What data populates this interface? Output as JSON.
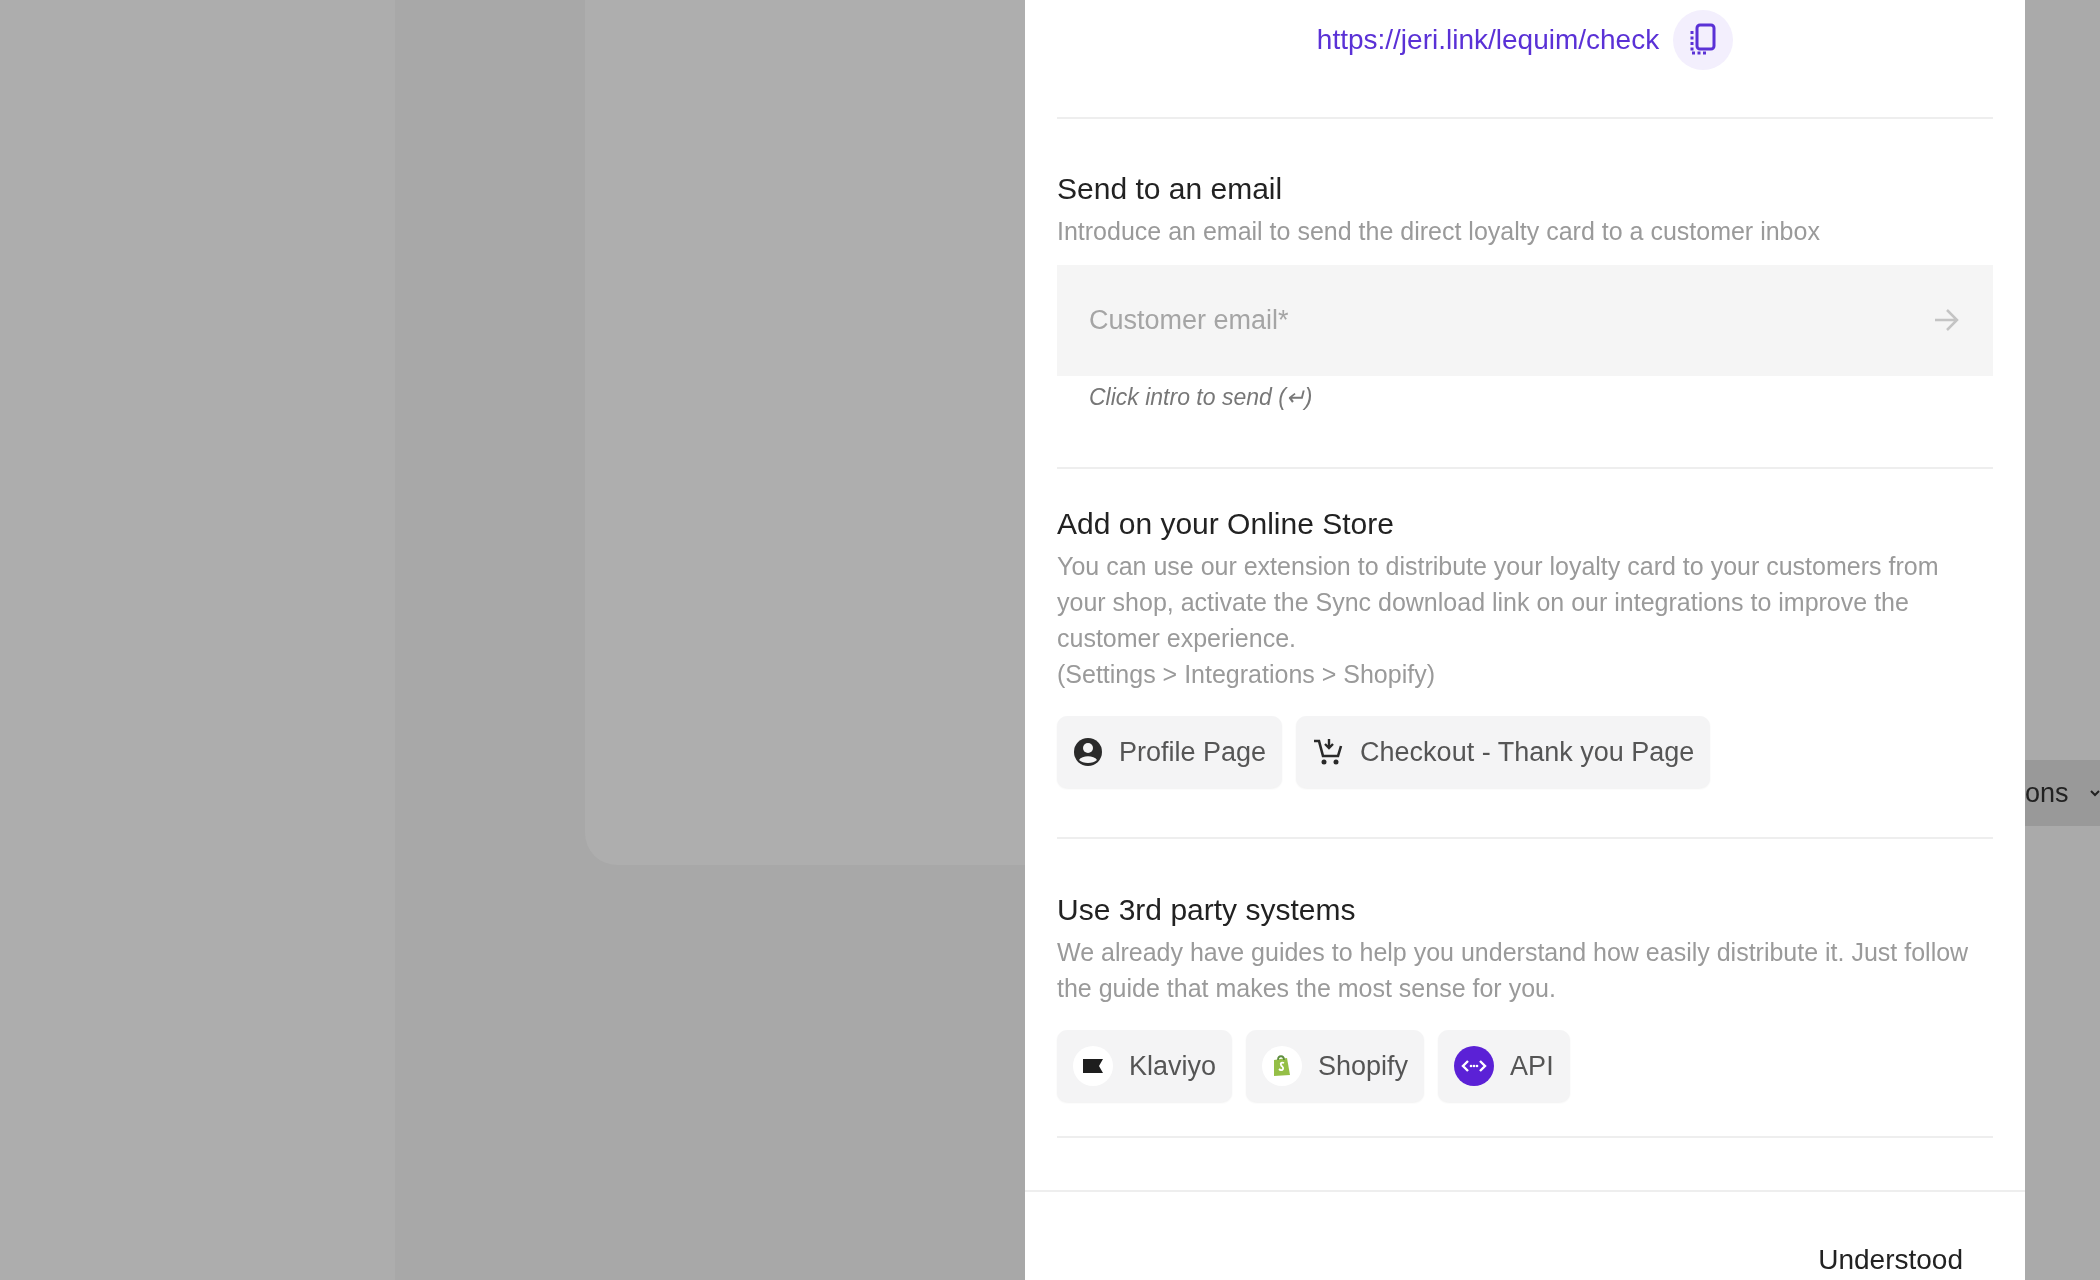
{
  "backdrop": {
    "tab_label": "ons"
  },
  "link": {
    "url": "https://jeri.link/lequim/check"
  },
  "sections": [
    {
      "kind": "email",
      "title": "Send to an email",
      "description": "Introduce an email to send the direct loyalty card to a customer inbox",
      "field": {
        "placeholder": "Customer email*"
      },
      "hint": "Click intro to send (↵)"
    },
    {
      "kind": "buttons",
      "title": "Add on your Online Store",
      "description": "You can use our extension to distribute your loyalty card to your customers from your shop, activate the Sync download link on our integrations to improve the customer experience.",
      "path": "(Settings > Integrations > Shopify)",
      "buttons": [
        {
          "label": "Profile Page",
          "kind": "profile"
        },
        {
          "label": "Checkout - Thank you Page",
          "kind": "checkout"
        }
      ]
    },
    {
      "kind": "buttons",
      "title": "Use 3rd party systems",
      "description": "We already have guides to help you understand how easily distribute it. Just follow the guide that makes the most sense for you.",
      "buttons": [
        {
          "label": "Klaviyo",
          "kind": "klaviyo"
        },
        {
          "label": "Shopify",
          "kind": "shopify"
        },
        {
          "label": "API",
          "kind": "api"
        }
      ]
    }
  ],
  "footer": {
    "button": "Understood"
  }
}
